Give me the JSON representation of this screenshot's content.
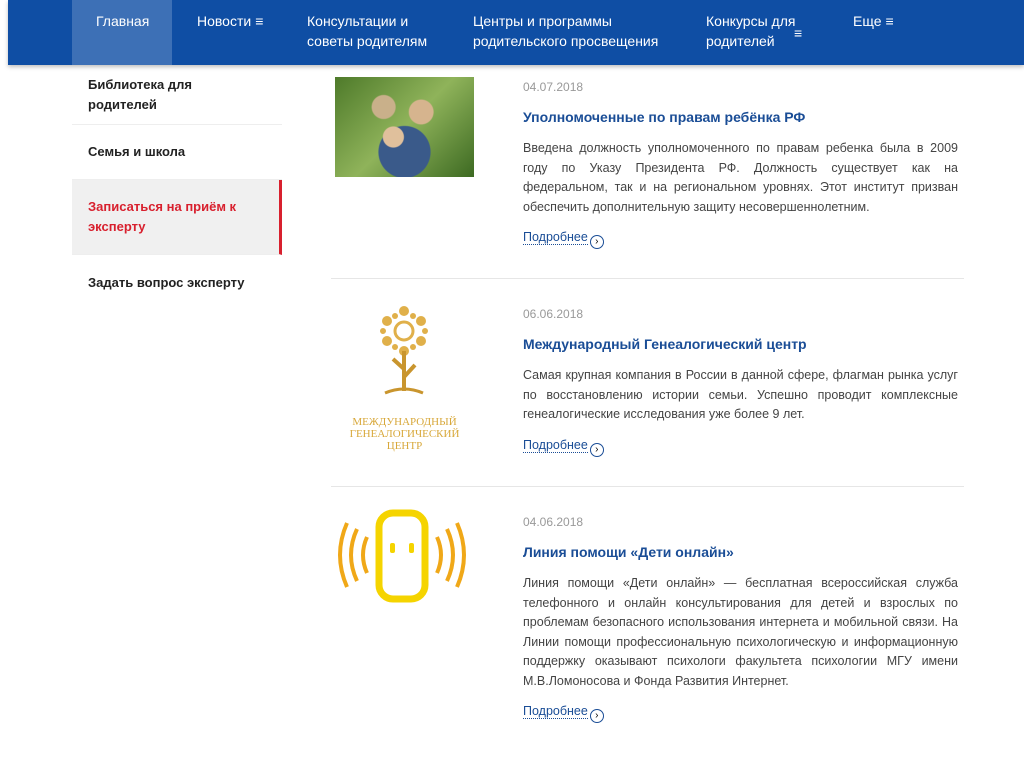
{
  "nav": {
    "items": [
      {
        "label": "Главная",
        "menu": false
      },
      {
        "label": "Новости",
        "menu": true
      },
      {
        "label": "Консультации и советы родителям",
        "menu": false
      },
      {
        "label": "Центры и программы родительского просвещения",
        "menu": false
      },
      {
        "label": "Конкурсы для родителей",
        "menu": true
      },
      {
        "label": "Еще",
        "menu": true
      }
    ],
    "menu_glyph": "≡"
  },
  "sidebar": {
    "items": [
      {
        "label": "Библиотека для родителей"
      },
      {
        "label": "Семья и школа"
      },
      {
        "label": "Записаться на приём к эксперту",
        "active": true
      },
      {
        "label": "Задать вопрос эксперту"
      }
    ]
  },
  "news": [
    {
      "date": "04.07.2018",
      "title": "Уполномоченные по правам ребёнка РФ",
      "text": "Введена должность уполномоченного по правам ребенка была в 2009 году по Указу Президента РФ. Должность существует как на федеральном, так и на региональном уровнях. Этот институт призван обеспечить дополнительную защиту несовершеннолетним.",
      "more": "Подробнее"
    },
    {
      "date": "06.06.2018",
      "title": "Международный Генеалогический центр",
      "text": "Самая крупная компания в России в данной сфере, флагман рынка услуг по восстановлению истории семьи. Успешно проводит комплексные генеалогические исследования уже более 9 лет.",
      "more": "Подробнее",
      "logo_text": "МЕЖДУНАРОДНЫЙ ГЕНЕАЛОГИЧЕСКИЙ ЦЕНТР"
    },
    {
      "date": "04.06.2018",
      "title": "Линия помощи «Дети онлайн»",
      "text": "Линия помощи «Дети онлайн» — бесплатная всероссийская служба телефонного и онлайн консультирования для детей и взрослых по проблемам безопасного использования интернета и мобильной связи. На Линии помощи профессиональную психологическую и информационную поддержку оказывают психологи факультета психологии МГУ имени М.В.Ломоносова и Фонда Развития Интернет.",
      "more": "Подробнее"
    }
  ],
  "colors": {
    "nav": "#0f4ea4",
    "accent": "#d8202e",
    "link": "#1a4d96"
  }
}
